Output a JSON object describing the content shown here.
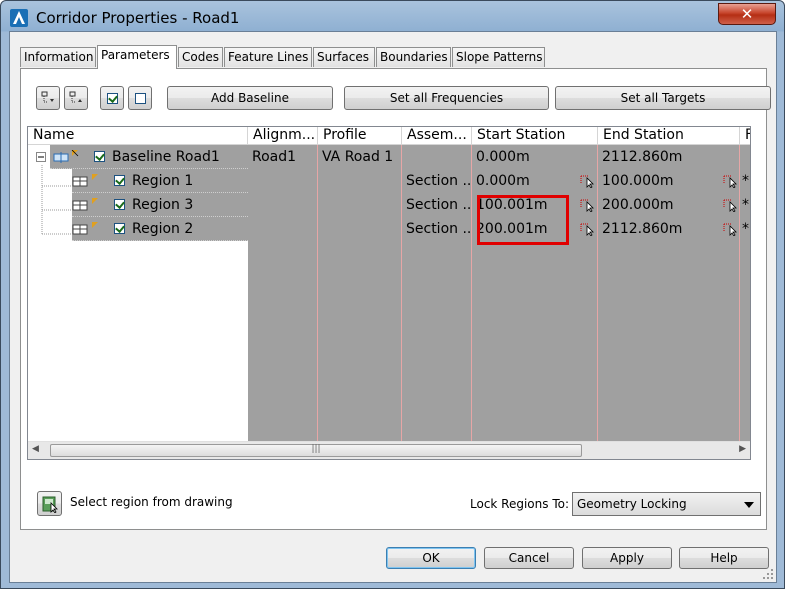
{
  "window": {
    "title": "Corridor Properties - Road1",
    "close_symbol": "✕"
  },
  "tabs": [
    {
      "label": "Information"
    },
    {
      "label": "Parameters"
    },
    {
      "label": "Codes"
    },
    {
      "label": "Feature Lines"
    },
    {
      "label": "Surfaces"
    },
    {
      "label": "Boundaries"
    },
    {
      "label": "Slope Patterns"
    }
  ],
  "toolbar": {
    "add_baseline": "Add Baseline",
    "set_all_frequencies": "Set all Frequencies",
    "set_all_targets": "Set all Targets"
  },
  "columns": {
    "name": "Name",
    "alignment": "Alignm...",
    "profile": "Profile",
    "assembly": "Assem...",
    "start_station": "Start Station",
    "end_station": "End Station",
    "extra": "F"
  },
  "rows": [
    {
      "name": "Baseline Road1",
      "alignment": "Road1",
      "profile": "VA Road 1",
      "assembly": "",
      "start": "0.000m",
      "end": "2112.860m",
      "extra": ""
    },
    {
      "name": "Region 1",
      "alignment": "",
      "profile": "",
      "assembly": "Section ...",
      "start": "0.000m",
      "end": "100.000m",
      "extra": "*"
    },
    {
      "name": "Region 3",
      "alignment": "",
      "profile": "",
      "assembly": "Section ...",
      "start": "100.001m",
      "end": "200.000m",
      "extra": "*"
    },
    {
      "name": "Region 2",
      "alignment": "",
      "profile": "",
      "assembly": "Section ...",
      "start": "200.001m",
      "end": "2112.860m",
      "extra": "*"
    }
  ],
  "bottom": {
    "select_region_label": "Select region from drawing",
    "lock_regions_label": "Lock Regions To:",
    "lock_regions_value": "Geometry Locking"
  },
  "buttons": {
    "ok": "OK",
    "cancel": "Cancel",
    "apply": "Apply",
    "help": "Help"
  },
  "scrollbar": {
    "left_arrow": "◀",
    "right_arrow": "▶",
    "grip": "|||"
  },
  "colors": {
    "grid_gray": "#a0a0a0",
    "highlight_red": "#e00000",
    "close_red": "#c7452c"
  }
}
